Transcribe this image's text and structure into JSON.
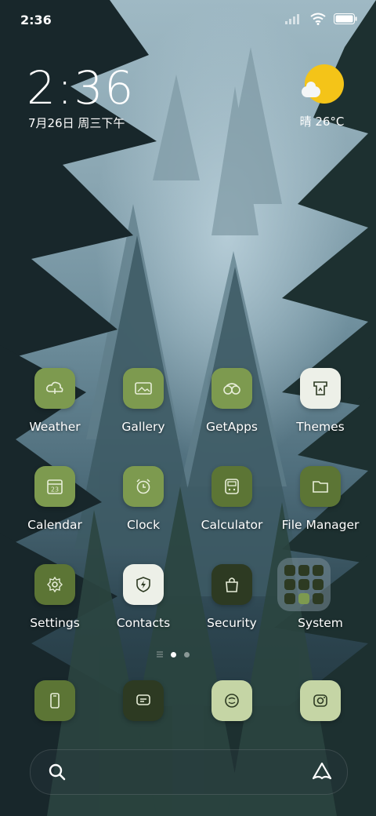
{
  "status_bar": {
    "time": "2:36"
  },
  "clock_widget": {
    "time": "2:36",
    "date": "7月26日 周三下午"
  },
  "weather_widget": {
    "text": "晴 26°C",
    "sun_color": "#f4c418"
  },
  "apps": [
    {
      "label": "Weather",
      "icon": "cloud-icon"
    },
    {
      "label": "Gallery",
      "icon": "image-icon"
    },
    {
      "label": "GetApps",
      "icon": "bag-icon"
    },
    {
      "label": "Themes",
      "icon": "shirt-icon"
    },
    {
      "label": "Calendar",
      "icon": "calendar-icon",
      "calendar_day": "23"
    },
    {
      "label": "Clock",
      "icon": "alarm-clock-icon"
    },
    {
      "label": "Calculator",
      "icon": "calculator-icon"
    },
    {
      "label": "File Manager",
      "icon": "folder-icon"
    },
    {
      "label": "Settings",
      "icon": "gear-icon"
    },
    {
      "label": "Contacts",
      "icon": "shield-bolt-icon"
    },
    {
      "label": "Security",
      "icon": "shopping-bag-icon"
    },
    {
      "label": "System",
      "icon": "folder-grid-icon"
    }
  ],
  "dock": [
    {
      "icon": "phone-icon"
    },
    {
      "icon": "message-icon"
    },
    {
      "icon": "browser-icon"
    },
    {
      "icon": "camera-icon"
    }
  ],
  "pager": {
    "pages": 2,
    "active": 1
  },
  "colors": {
    "green_light": "#7d9a4f",
    "green_mid": "#5c7535",
    "green_dark": "#2d3a22",
    "pale": "#c5d5a5",
    "white_icon": "#edf0e8"
  }
}
